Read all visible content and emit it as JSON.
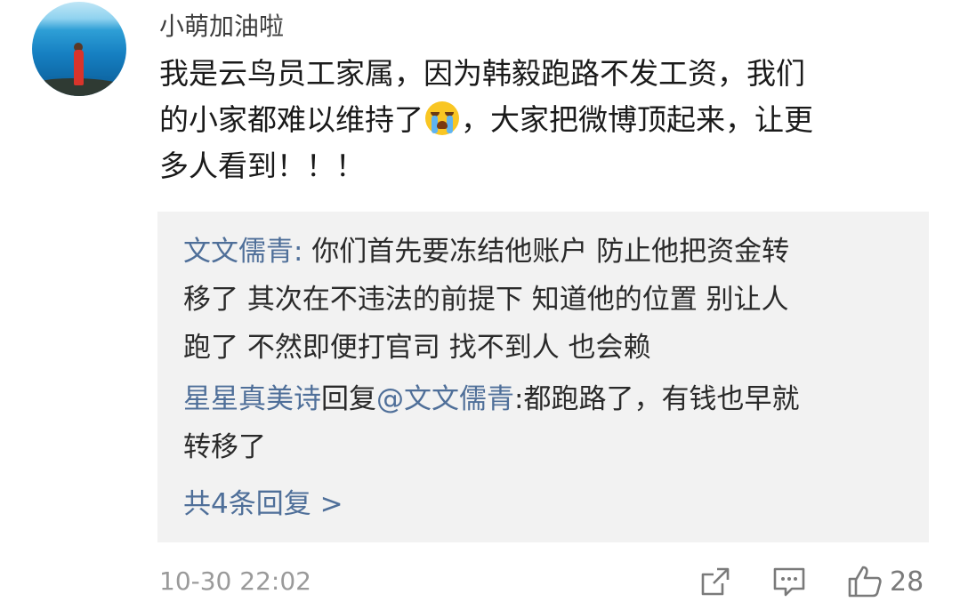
{
  "comment": {
    "username": "小萌加油啦",
    "lines": [
      "我是云鸟员工家属，因为韩毅跑路不发工资，我们",
      "的小家都难以维持了",
      "，大家把微博顶起来，让更",
      "多人看到！！！"
    ],
    "emoji_icon": "crying-face-emoji",
    "timestamp": "10-30 22:02",
    "like_count": "28"
  },
  "replies": [
    {
      "author": "文文儒青",
      "separator": ": ",
      "lines": [
        "你们首先要冻结他账户 防止他把资金转",
        "移了 其次在不违法的前提下 知道他的位置 别让人",
        "跑了 不然即便打官司 找不到人 也会赖"
      ]
    },
    {
      "author": "星星真美诗",
      "reply_word": "回复",
      "mention": "@文文儒青",
      "separator": ":",
      "lines": [
        "都跑路了，有钱也早就",
        "转移了"
      ]
    }
  ],
  "more_replies": "共4条回复 >",
  "icons": {
    "share": "share-icon",
    "comment": "comment-icon",
    "like": "thumbs-up-icon"
  },
  "colors": {
    "link_blue": "#4f6f99",
    "reply_bg": "#f2f2f2",
    "meta_gray": "#9a9a9a"
  }
}
